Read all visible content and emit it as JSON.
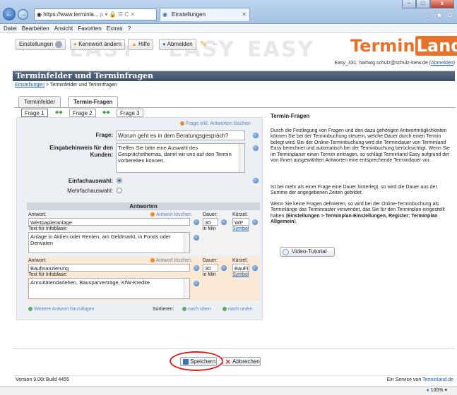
{
  "browser": {
    "url_host": "https://www.terminla...",
    "url_controls": "ρ ▾ 🔒 ☰ C ✕",
    "tab_title": "Einstellungen",
    "window_controls": [
      "–",
      "□",
      "x"
    ]
  },
  "menu": [
    "Datei",
    "Bearbeiten",
    "Ansicht",
    "Favoriten",
    "Extras",
    "?"
  ],
  "toolbar": {
    "settings": "Einstellungen",
    "password": "Kennwort ändern",
    "help": "Hilfe",
    "logout": "Abmelden",
    "ghost_text": "EASY",
    "brand_left": "Termin",
    "brand_right": "Land",
    "user_prefix": "Easy_331: hartwig.schulz@schulz-loew.de (",
    "user_link": "Abmelden",
    "user_suffix": ")"
  },
  "page": {
    "title": "Terminfelder und Terminfragen",
    "breadcrumb_link": "Einstellungen",
    "breadcrumb_rest": " > Terminfelder und Terminfragen"
  },
  "tabs": [
    "Terminfelder",
    "Termin-Fragen"
  ],
  "subtabs": [
    "Frage 1",
    "Frage 2",
    "Frage 3"
  ],
  "subtab_arrows": "◆◆",
  "form": {
    "link_frage_incl": "Frage inkl. Antworten löschen",
    "frage_label": "Frage:",
    "frage_value": "Worum geht es in dem Beratungsgespräch?",
    "hinweis_label": "Eingabehinweis für den Kunden:",
    "hinweis_value": "Treffen Sie bitte eine Auswahl des Gesprächsthemas, damit wir uns auf den Termin vorbereiten können.",
    "einfach_label": "Einfachauswahl:",
    "mehrfach_label": "Mehrfachauswahl:"
  },
  "antworten": {
    "header": "Antworten",
    "antwort_label": "Antwort:",
    "delete_link": "Antwort löschen",
    "dauer_label": "Dauer:",
    "kuerzel_label": "Kürzel:",
    "infobox_label": "Text für Infoblase:",
    "in_min": "in Min",
    "symbol_link": "Symbol",
    "items": [
      {
        "antwort": "Wertpapieranlage",
        "dauer": "30",
        "kuerzel": "WP",
        "infobox": "Anlage in Aktien oder Renten, am Geldmarkt, in Fonds oder Derivaten"
      },
      {
        "antwort": "Baufinanzierung",
        "dauer": "30",
        "kuerzel": "BauFi",
        "infobox": "Annuitätendarlehen, Bausparverträge, KfW-Kredite"
      }
    ],
    "add_link": "Weitere Antwort hinzufügen",
    "sort_label": "Sortieren:",
    "sort_up": "nach oben",
    "sort_down": "nach unten"
  },
  "info": {
    "title": "Termin-Fragen",
    "p1": "Durch die Festlegung von Fragen und den dazu gehörigen Antwortmöglichkeiten können Sie bei der Terminbuchung steuern, welche Dauer durch einen Termin belegt wird. Bei der Online-Terminbuchung wird die Termindauer von Terminland Easy berechnet und automatisch bei der Terminbuchung berücksichtigt. Wenn Sie im Terminplaner einen Termin eintragen, so schlägt Terminland Easy aufgrund der von Ihnen ausgewählten Antworten eine entsprechende Termindauer vor.",
    "p2": "Ist bei mehr als einer Frage eine Dauer hinterlegt, so wird die Dauer aus der Summe der angegebenen Zeiten gebildet.",
    "p3_start": "Wenn Sie keine Fragen definieren, so wird bei der Online-Terminbuchung als Terminlänge das Terminraster verwendet, das Sie für den Terminplan eingestellt haben (",
    "p3_bold": "Einstellungen > Terminplan-Einstellungen, Register: Terminplan Allgemein",
    "p3_end": ").",
    "video": "Video-Tutorial"
  },
  "buttons": {
    "save": "Speichern",
    "cancel": "Abbrechen"
  },
  "footer": {
    "version": "Version 9.06t Build 4455",
    "service_prefix": "Ein Service von ",
    "service_link": "Terminland.de"
  },
  "status": {
    "zoom": "100%"
  }
}
